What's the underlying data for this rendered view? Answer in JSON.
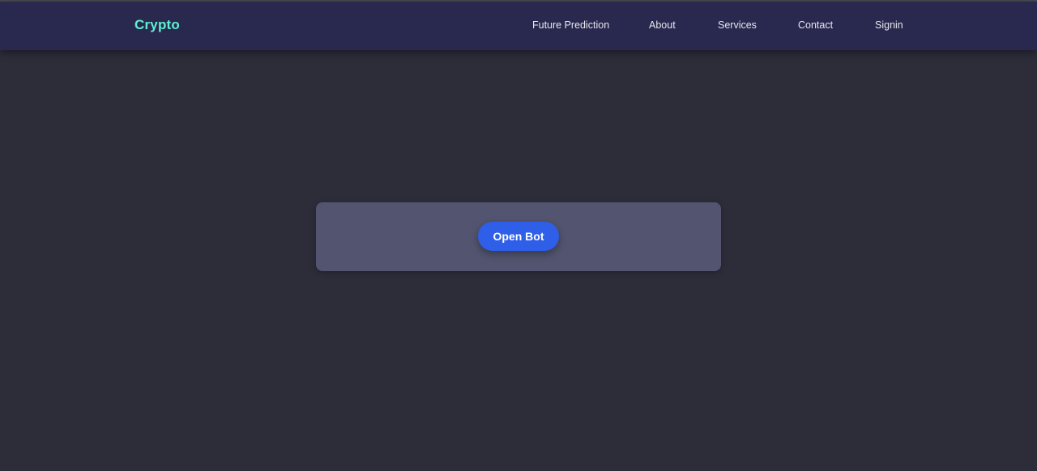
{
  "navbar": {
    "brand": "Crypto",
    "brand_color": "#5ff0d0",
    "background_color": "#29294f",
    "links": [
      {
        "label": "Future Prediction"
      },
      {
        "label": "About"
      },
      {
        "label": "Services"
      },
      {
        "label": "Contact"
      },
      {
        "label": "Signin"
      }
    ]
  },
  "main": {
    "background_color": "#2d2d3a",
    "bot_card": {
      "background_color": "#535570",
      "button_label": "Open Bot",
      "button_color": "#2f5fe8"
    }
  }
}
